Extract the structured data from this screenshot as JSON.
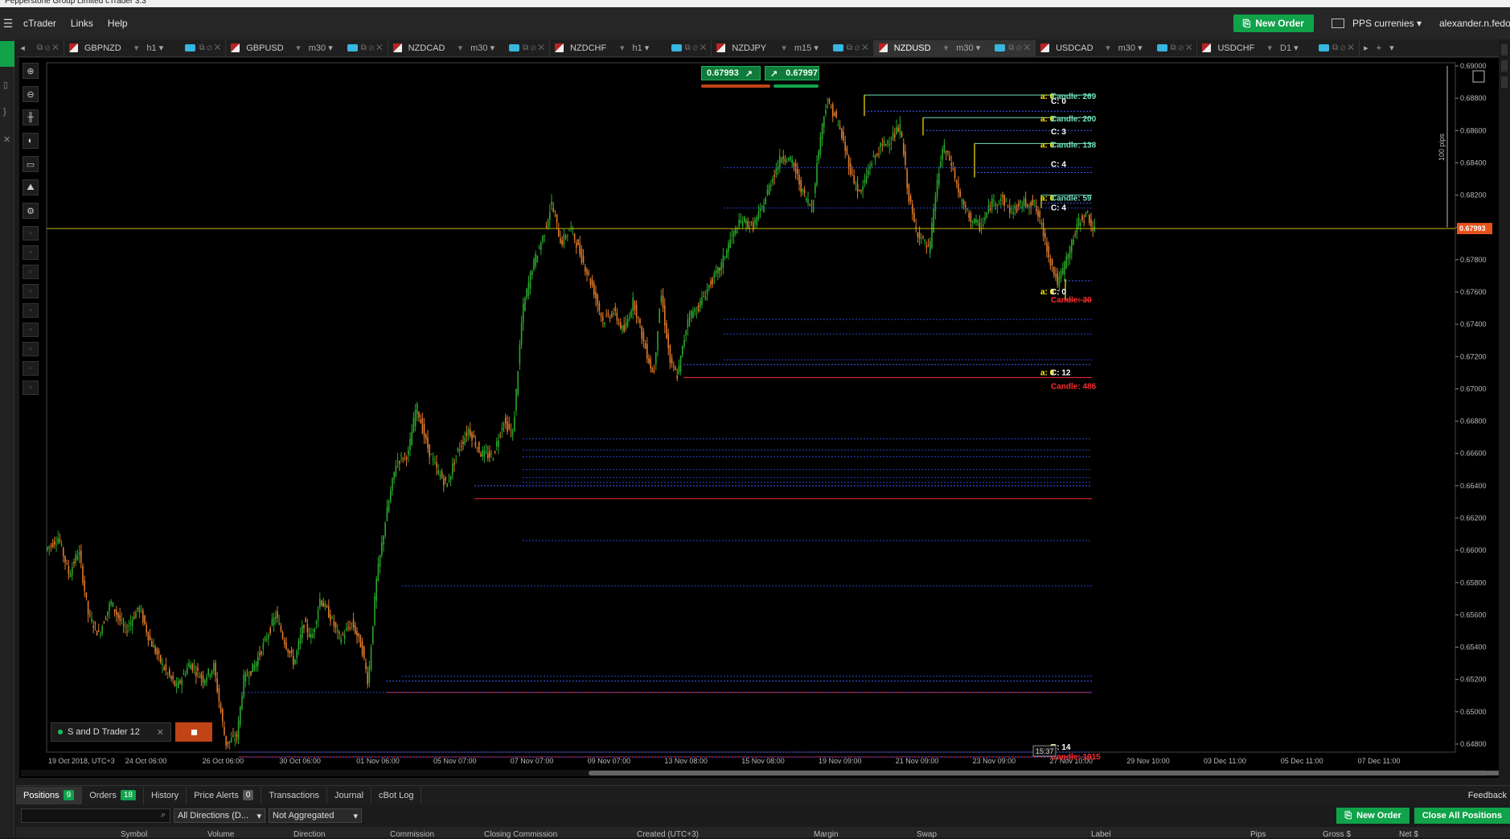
{
  "window": {
    "title": "Pepperstone Group Limited cTrader 3.3"
  },
  "menu": {
    "items": [
      "cTrader",
      "Links",
      "Help"
    ]
  },
  "header": {
    "new_order": "New Order",
    "workspace": "PPS currenies",
    "user": "alexander.n.fedorov"
  },
  "tabs": [
    {
      "symbol": "GBPNZD",
      "timeframe": "h1",
      "active": false
    },
    {
      "symbol": "GBPUSD",
      "timeframe": "m30",
      "active": false
    },
    {
      "symbol": "NZDCAD",
      "timeframe": "m30",
      "active": false
    },
    {
      "symbol": "NZDCHF",
      "timeframe": "h1",
      "active": false
    },
    {
      "symbol": "NZDJPY",
      "timeframe": "m15",
      "active": false
    },
    {
      "symbol": "NZDUSD",
      "timeframe": "m30",
      "active": true
    },
    {
      "symbol": "USDCAD",
      "timeframe": "m30",
      "active": false
    },
    {
      "symbol": "USDCHF",
      "timeframe": "D1",
      "active": false
    }
  ],
  "chart": {
    "sell_price": "0.67993",
    "buy_price": "0.67997",
    "current_price_label": "0.67993",
    "pips_label": "100 pips",
    "time_marker": "15:37",
    "x_labels": [
      "19 Oct 2018, UTC+3",
      "24 Oct 06:00",
      "26 Oct 06:00",
      "30 Oct 06:00",
      "01 Nov 06:00",
      "05 Nov 07:00",
      "07 Nov 07:00",
      "09 Nov 07:00",
      "13 Nov 08:00",
      "15 Nov 08:00",
      "19 Nov 09:00",
      "21 Nov 09:00",
      "23 Nov 09:00",
      "27 Nov 10:00",
      "29 Nov 10:00",
      "03 Dec 11:00",
      "05 Dec 11:00",
      "07 Dec 11:00"
    ],
    "y_labels": [
      "0.69000",
      "0.68800",
      "0.68600",
      "0.68400",
      "0.68200",
      "0.68000",
      "0.67800",
      "0.67600",
      "0.67400",
      "0.67200",
      "0.67000",
      "0.66800",
      "0.66600",
      "0.66400",
      "0.66200",
      "0.66000",
      "0.65800",
      "0.65600",
      "0.65400",
      "0.65200",
      "0.65000",
      "0.64800"
    ],
    "annotations": [
      {
        "a": "a: 0",
        "c": "C: 0",
        "candle": "Candle: 269",
        "kind": "supply"
      },
      {
        "a": "a: 0",
        "c": "C: 3",
        "candle": "Candle: 200",
        "kind": "supply"
      },
      {
        "a": "a: 0",
        "c": "C: 4",
        "candle": "Candle: 138",
        "kind": "supply"
      },
      {
        "a": "a: 0",
        "c": "C: 4",
        "candle": "Candle: 59",
        "kind": "supply"
      },
      {
        "a": "a: 0",
        "c": "C: 0",
        "candle": "Candle: 30",
        "kind": "demand"
      },
      {
        "a": "a: 0",
        "c": "C: 12",
        "candle": "Candle: 486",
        "kind": "demand"
      },
      {
        "a": "a: 0",
        "c": "C: 14",
        "candle": "Candle: 1015",
        "kind": "demand"
      }
    ]
  },
  "bot": {
    "name": "S and  D Trader 12"
  },
  "bottom_tabs": [
    {
      "label": "Positions",
      "count": "9"
    },
    {
      "label": "Orders",
      "count": "18"
    },
    {
      "label": "History",
      "count": ""
    },
    {
      "label": "Price Alerts",
      "count": "0"
    },
    {
      "label": "Transactions",
      "count": ""
    },
    {
      "label": "Journal",
      "count": ""
    },
    {
      "label": "cBot Log",
      "count": ""
    }
  ],
  "feedback": "Feedback",
  "filters": {
    "directions": "All Directions (D...",
    "aggregation": "Not Aggregated",
    "new_order": "New Order",
    "close_all": "Close All Positions"
  },
  "columns": [
    "Symbol",
    "Volume",
    "Direction",
    "Commission",
    "Closing Commission",
    "Created (UTC+3)",
    "Margin",
    "Swap",
    "Label",
    "Pips",
    "Gross $",
    "Net $"
  ],
  "colors": {
    "accent": "#10a34a",
    "price_line": "#c8b400",
    "supply_line": "#6fe0c0",
    "demand_line": "#ff2a2a",
    "bull": "#2aa82a",
    "bear": "#e07a2a"
  }
}
